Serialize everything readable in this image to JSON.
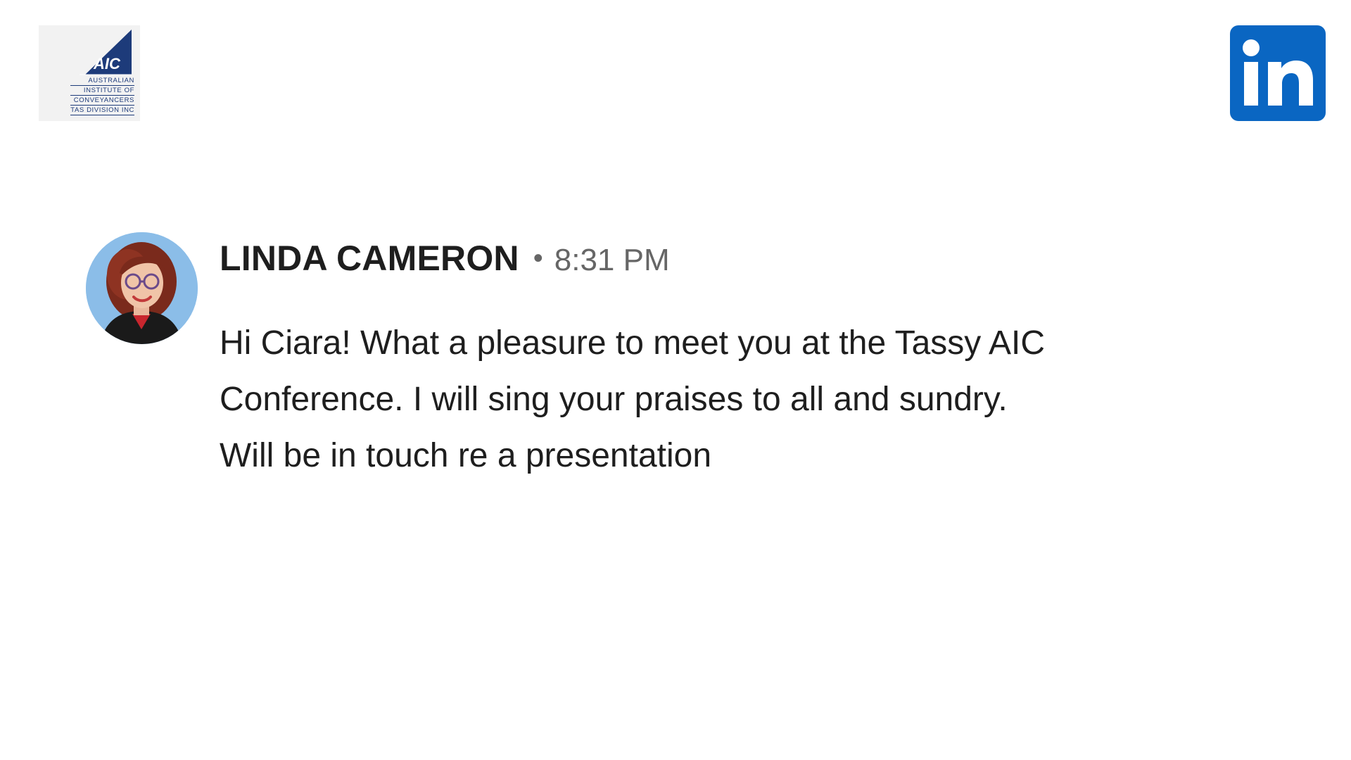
{
  "header": {
    "aic_logo": {
      "mark": "AIC",
      "lines": [
        "AUSTRALIAN",
        "INSTITUTE OF",
        "CONVEYANCERS",
        "TAS DIVISION INC"
      ],
      "color": "#1d3b7a"
    },
    "linkedin_logo": {
      "icon": "linkedin-icon",
      "color": "#0a66c2"
    }
  },
  "message": {
    "sender": "LINDA CAMERON",
    "separator": "•",
    "time": "8:31 PM",
    "avatar": "avatar-photo",
    "body_lines": [
      "Hi Ciara! What a pleasure to meet you at the Tassy AIC",
      "Conference. I will sing your praises to all and sundry.",
      "Will be in touch re a presentation"
    ]
  }
}
